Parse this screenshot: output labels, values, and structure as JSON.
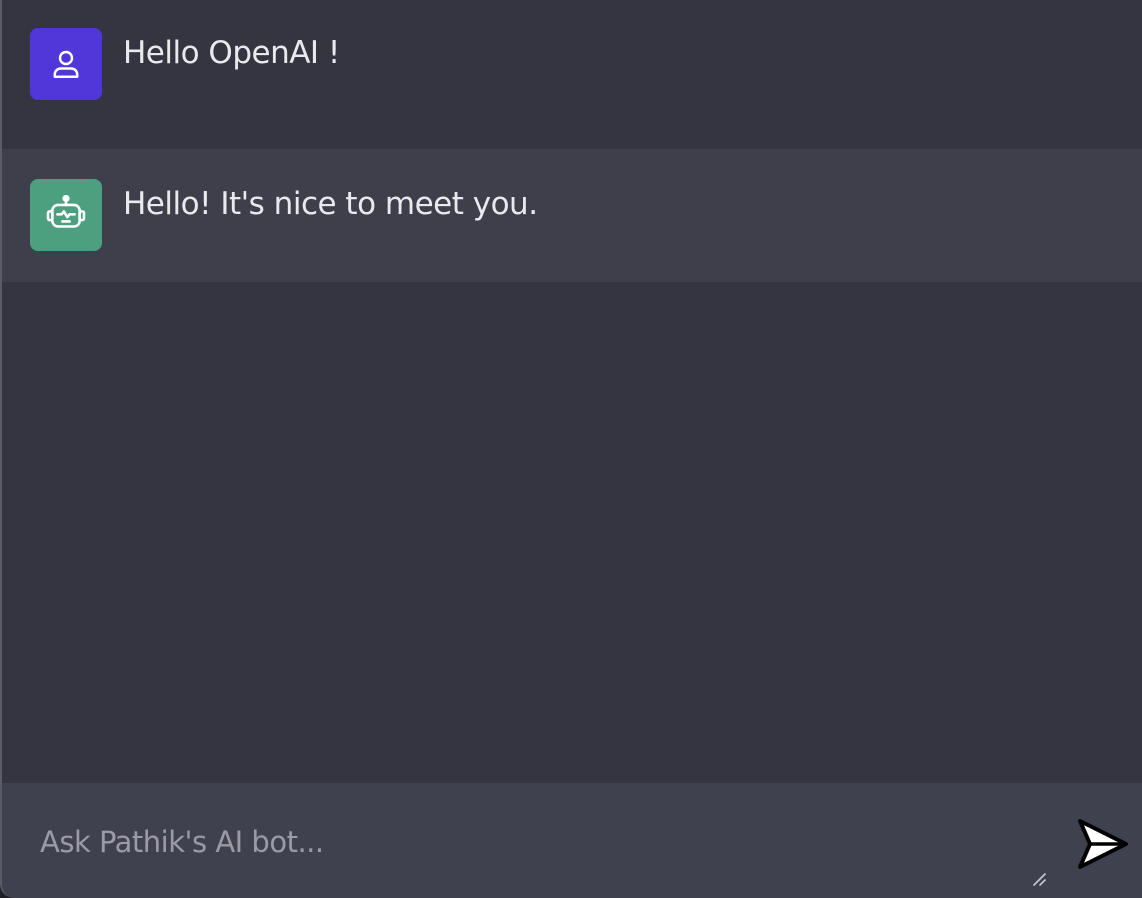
{
  "messages": [
    {
      "role": "user",
      "avatar_icon": "user-icon",
      "avatar_color": "#5137d9",
      "text": "Hello OpenAI !"
    },
    {
      "role": "assistant",
      "avatar_icon": "robot-icon",
      "avatar_color": "#4c9f7f",
      "text": "Hello! It's nice to meet you."
    }
  ],
  "composer": {
    "placeholder": "Ask Pathik's AI bot...",
    "value": "",
    "send_icon": "send-icon"
  },
  "colors": {
    "background": "#343541",
    "assistant_row": "#3e3f4b",
    "composer": "#40414f",
    "user_accent": "#5137d9",
    "bot_accent": "#4c9f7f"
  }
}
